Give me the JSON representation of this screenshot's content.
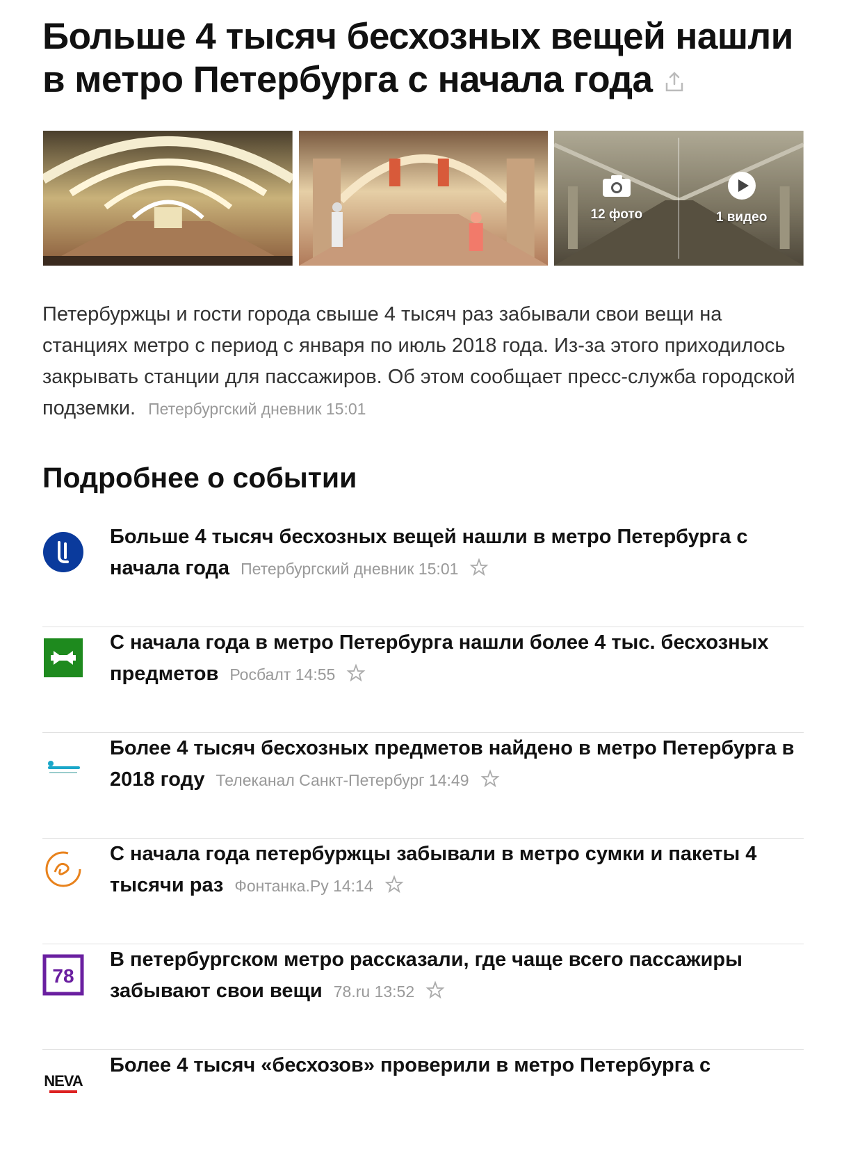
{
  "article": {
    "title": "Больше 4 тысяч бесхозных вещей нашли в метро Петербурга с начала года",
    "lead": "Петербуржцы и гости города свыше 4 тысяч раз забывали свои вещи на станциях метро с период с января по июль 2018 года. Из-за этого приходилось закрывать станции для пассажиров. Об этом сообщает пресс-служба городской подземки.",
    "lead_source": "Петербургский дневник 15:01"
  },
  "media": {
    "photos_label": "12 фото",
    "video_label": "1 видео"
  },
  "section": {
    "title": "Подробнее о событии"
  },
  "stories": [
    {
      "headline": "Больше 4 тысяч бесхозных вещей нашли в метро Петербурга с начала года",
      "meta": "Петербургский дневник 15:01",
      "logo": "spb-diary-logo",
      "color": "#0a3a9c"
    },
    {
      "headline": "С начала года в метро Петербурга нашли более 4 тыс. бесхозных предметов",
      "meta": "Росбалт 14:55",
      "logo": "rosbalt-logo",
      "color": "#1e8a1e"
    },
    {
      "headline": "Более 4 тысяч бесхозных предметов найдено в метро Петербурга в 2018 году",
      "meta": "Телеканал Санкт-Петербург 14:49",
      "logo": "spb-tv-logo",
      "color": "#1aa7c9"
    },
    {
      "headline": "С начала года петербуржцы забывали в метро сумки и пакеты 4 тысячи раз",
      "meta": "Фонтанка.Ру 14:14",
      "logo": "fontanka-logo",
      "color": "#e8821c"
    },
    {
      "headline": "В петербургском метро рассказали, где чаще всего пассажиры забывают свои вещи",
      "meta": "78.ru 13:52",
      "logo": "78-logo",
      "logo_text": "78",
      "color": "#6a1fa0"
    },
    {
      "headline": "Более 4 тысяч «бесхозов» проверили в метро Петербурга с",
      "meta": "",
      "logo": "neva-today-logo",
      "logo_text": "NEVA",
      "color": "#111111"
    }
  ]
}
